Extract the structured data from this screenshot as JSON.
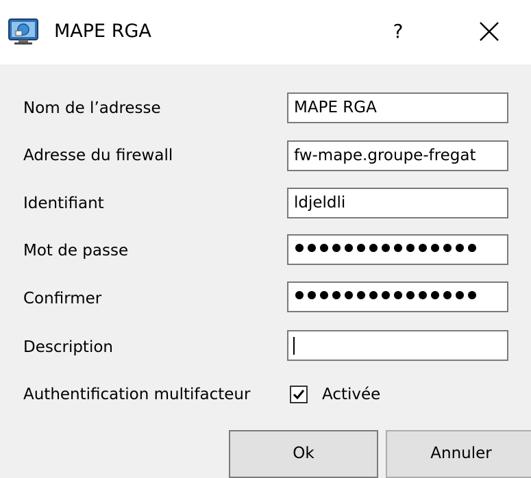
{
  "window": {
    "title": "MAPE RGA",
    "help_label": "?",
    "icon": "network-computer-icon",
    "close_icon": "close-icon"
  },
  "form": {
    "name_label": "Nom de l’adresse",
    "name_value": "MAPE RGA",
    "firewall_label": "Adresse du firewall",
    "firewall_value": "fw-mape.groupe-fregat",
    "identifier_label": "Identifiant",
    "identifier_value": "ldjeldli",
    "password_label": "Mot de passe",
    "confirm_label": "Confirmer",
    "description_label": "Description",
    "description_value": "",
    "mfa_label": "Authentification multifacteur",
    "mfa_checkbox_label": "Activée"
  },
  "buttons": {
    "ok_label": "Ok",
    "cancel_label": "Annuler"
  }
}
